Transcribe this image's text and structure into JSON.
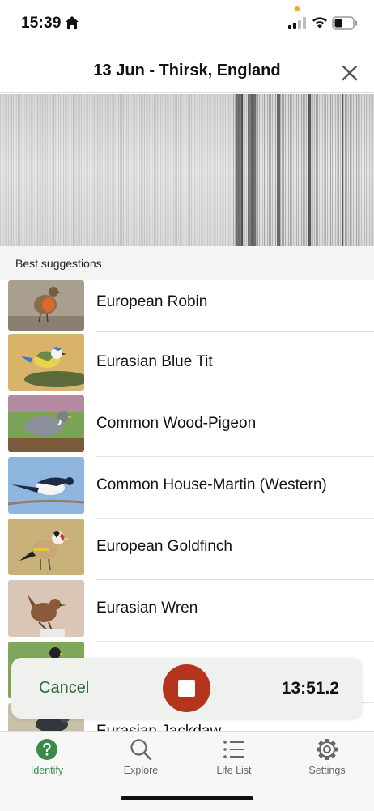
{
  "status_bar": {
    "time": "15:39"
  },
  "header": {
    "title": "13 Jun - Thirsk, England"
  },
  "section": {
    "title": "Best suggestions"
  },
  "suggestions": [
    {
      "name": "European Robin"
    },
    {
      "name": "Eurasian Blue Tit"
    },
    {
      "name": "Common Wood-Pigeon"
    },
    {
      "name": "Common House-Martin (Western)"
    },
    {
      "name": "European Goldfinch"
    },
    {
      "name": "Eurasian Wren"
    },
    {
      "name": ""
    },
    {
      "name": "Eurasian Jackdaw"
    }
  ],
  "recording": {
    "cancel_label": "Cancel",
    "timer": "13:51.2",
    "stop_color": "#b4341d"
  },
  "tabs": [
    {
      "label": "Identify",
      "icon": "question-circle-icon",
      "active": true
    },
    {
      "label": "Explore",
      "icon": "search-icon",
      "active": false
    },
    {
      "label": "Life List",
      "icon": "list-icon",
      "active": false
    },
    {
      "label": "Settings",
      "icon": "gear-icon",
      "active": false
    }
  ],
  "colors": {
    "accent_green": "#3a8a4a",
    "cancel_green": "#2e6b3a"
  }
}
